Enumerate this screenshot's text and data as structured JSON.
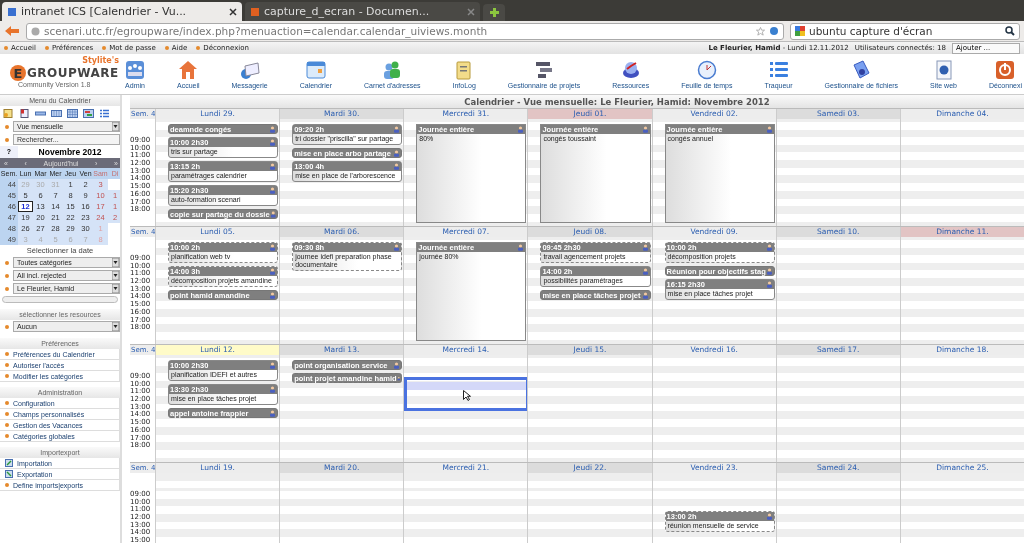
{
  "browser": {
    "tabs": [
      {
        "title": "intranet ICS [Calendrier - Vu...",
        "selected": true
      },
      {
        "title": "capture_d_ecran - Documen...",
        "selected": false
      }
    ],
    "url": "scenari.utc.fr/egroupware/index.php?menuaction=calendar.calendar_uiviews.month",
    "search": "ubuntu capture d'écran"
  },
  "top_links": [
    "Accueil",
    "Préférences",
    "Mot de passe",
    "Aide",
    "Déconnexion"
  ],
  "user_info": "**Le Fleurier, Hamid** - Lundi 12.11.2012",
  "users_online": "Utilisateurs connectés: 18",
  "add_select": "Ajouter ...",
  "logo": {
    "tagline": "Stylite's",
    "letter": "E",
    "name": "GROUPWARE",
    "version": "Community Version 1.8"
  },
  "apps": [
    "Admin",
    "Accueil",
    "Messagerie",
    "Calendrier",
    "Carnet d'adresses",
    "InfoLog",
    "Gestionnaire de projets",
    "Ressources",
    "Feuille de temps",
    "Traqueur",
    "Gestionnaire de fichiers",
    "Site web",
    "Déconnexi"
  ],
  "sidebar": {
    "title": "Menu du Calendrier",
    "view_select": "Vue mensuelle",
    "search_placeholder": "Rechercher...",
    "minical": {
      "help": "?",
      "month": "Novembre 2012",
      "nav": [
        "«",
        "‹",
        "Aujourd'hui",
        "›",
        "»"
      ],
      "heads": [
        "Sem.",
        "Lun",
        "Mar",
        "Mer",
        "Jeu",
        "Ven",
        "Sam",
        "Di"
      ],
      "weeks": [
        {
          "week": "44",
          "days": [
            {
              "label": "29",
              "kind": "other",
              "selected": false
            },
            {
              "label": "30",
              "kind": "other",
              "selected": false
            },
            {
              "label": "31",
              "kind": "other",
              "selected": false
            },
            {
              "label": "1",
              "kind": "day",
              "selected": false
            },
            {
              "label": "2",
              "kind": "day",
              "selected": false
            },
            {
              "label": "3",
              "kind": "weekend",
              "selected": false
            }
          ]
        },
        {
          "week": "45",
          "days": [
            {
              "label": "5",
              "kind": "day",
              "selected": false
            },
            {
              "label": "6",
              "kind": "day",
              "selected": false
            },
            {
              "label": "7",
              "kind": "day",
              "selected": false
            },
            {
              "label": "8",
              "kind": "day",
              "selected": false
            },
            {
              "label": "9",
              "kind": "day",
              "selected": false
            },
            {
              "label": "10",
              "kind": "weekend",
              "selected": false
            },
            {
              "label": "1",
              "kind": "weekend",
              "selected": false
            }
          ]
        },
        {
          "week": "46",
          "days": [
            {
              "label": "12",
              "kind": "day",
              "selected": true
            },
            {
              "label": "13",
              "kind": "day",
              "selected": false
            },
            {
              "label": "14",
              "kind": "day",
              "selected": false
            },
            {
              "label": "15",
              "kind": "day",
              "selected": false
            },
            {
              "label": "16",
              "kind": "day",
              "selected": false
            },
            {
              "label": "17",
              "kind": "weekend",
              "selected": false
            },
            {
              "label": "1",
              "kind": "weekend",
              "selected": false
            }
          ]
        },
        {
          "week": "47",
          "days": [
            {
              "label": "19",
              "kind": "day",
              "selected": false
            },
            {
              "label": "20",
              "kind": "day",
              "selected": false
            },
            {
              "label": "21",
              "kind": "day",
              "selected": false
            },
            {
              "label": "22",
              "kind": "day",
              "selected": false
            },
            {
              "label": "23",
              "kind": "day",
              "selected": false
            },
            {
              "label": "24",
              "kind": "weekend",
              "selected": false
            },
            {
              "label": "2",
              "kind": "weekend",
              "selected": false
            }
          ]
        },
        {
          "week": "48",
          "days": [
            {
              "label": "26",
              "kind": "day",
              "selected": false
            },
            {
              "label": "27",
              "kind": "day",
              "selected": false
            },
            {
              "label": "28",
              "kind": "day",
              "selected": false
            },
            {
              "label": "29",
              "kind": "day",
              "selected": false
            },
            {
              "label": "30",
              "kind": "day",
              "selected": false
            },
            {
              "label": "1",
              "kind": "other_weekend",
              "selected": false
            }
          ]
        },
        {
          "week": "49",
          "days": [
            {
              "label": "3",
              "kind": "other",
              "selected": false
            },
            {
              "label": "4",
              "kind": "other",
              "selected": false
            },
            {
              "label": "5",
              "kind": "other",
              "selected": false
            },
            {
              "label": "6",
              "kind": "other",
              "selected": false
            },
            {
              "label": "7",
              "kind": "other",
              "selected": false
            },
            {
              "label": "8",
              "kind": "other_weekend",
              "selected": false
            }
          ]
        }
      ],
      "caption": "Sélectionner la date"
    },
    "filters": [
      "Toutes catégories",
      "All incl. rejected",
      "Le Fleurier, Hamid"
    ],
    "resources": {
      "title": "sélectionner les resources",
      "select": "Aucun"
    },
    "sections": [
      {
        "title": "Préférences",
        "items": [
          {
            "label": "Préférences du Calendrier",
            "kind": "bullet"
          },
          {
            "label": "Autoriser l'accès",
            "kind": "bullet"
          },
          {
            "label": "Modifier les catégories",
            "kind": "bullet"
          }
        ]
      },
      {
        "title": "Administration",
        "items": [
          {
            "label": "Configuration",
            "kind": "bullet"
          },
          {
            "label": "Champs personnalisés",
            "kind": "bullet"
          },
          {
            "label": "Gestion des Vacances",
            "kind": "bullet"
          },
          {
            "label": "Catégories globales",
            "kind": "bullet"
          }
        ]
      },
      {
        "title": "Importexport",
        "items": [
          {
            "label": "Importation",
            "kind": "import"
          },
          {
            "label": "Exportation",
            "kind": "export"
          },
          {
            "label": "Define imports|exports",
            "kind": "bullet"
          }
        ]
      }
    ]
  },
  "calendar": {
    "title": "Calendrier - Vue mensuelle: Le Fleurier, Hamid: Novembre 2012",
    "weeks": [
      {
        "label": "Sem. 4",
        "hours": [
          "09:00",
          "10:00",
          "11:00",
          "12:00",
          "13:00",
          "14:00",
          "15:00",
          "16:00",
          "17:00",
          "18:00"
        ],
        "days": [
          {
            "label": "Lundi 29.",
            "today": false,
            "holiday": false,
            "selected": false,
            "events": [
              {
                "kind": "bar",
                "title": "deamnde congés",
                "dashed": false
              },
              {
                "kind": "timed",
                "title": "10:00 2h30",
                "text": "tris sur partage",
                "dashed": false
              },
              {
                "kind": "timed",
                "title": "13:15 2h",
                "text": "paramétrages calendrier",
                "dashed": false
              },
              {
                "kind": "timed",
                "title": "15:20 2h30",
                "text": "auto-formation scenari",
                "dashed": false
              },
              {
                "kind": "bar",
                "title": "copie sur partage du dossie",
                "dashed": false
              }
            ]
          },
          {
            "label": "Mardi 30.",
            "today": false,
            "holiday": false,
            "selected": false,
            "events": [
              {
                "kind": "timed",
                "title": "09:20 2h",
                "text": "tri dossier \"priscilla\" sur partage",
                "dashed": false
              },
              {
                "kind": "bar",
                "title": "mise en place arbo partage",
                "dashed": false
              },
              {
                "kind": "timed",
                "title": "13:00 4h",
                "text": "mise en place de l'arborescence",
                "dashed": false
              }
            ]
          },
          {
            "label": "Mercredi 31.",
            "today": false,
            "holiday": false,
            "selected": false,
            "events": [
              {
                "kind": "allday",
                "title": "Journée entière",
                "text": "80%",
                "dashed": false
              }
            ]
          },
          {
            "label": "Jeudi 01.",
            "today": false,
            "holiday": true,
            "selected": false,
            "events": [
              {
                "kind": "allday",
                "title": "Journée entière",
                "text": "congés toussaint",
                "dashed": false
              }
            ]
          },
          {
            "label": "Vendredi 02.",
            "today": false,
            "holiday": false,
            "selected": false,
            "events": [
              {
                "kind": "allday",
                "title": "Journée entière",
                "text": "congés annuel",
                "dashed": false
              }
            ]
          },
          {
            "label": "Samedi 03.",
            "today": false,
            "holiday": false,
            "selected": false
          },
          {
            "label": "Dimanche 04.",
            "today": false,
            "holiday": false,
            "selected": false
          }
        ]
      },
      {
        "label": "Sem. 4",
        "hours": [
          "09:00",
          "10:00",
          "11:00",
          "12:00",
          "13:00",
          "14:00",
          "15:00",
          "16:00",
          "17:00",
          "18:00"
        ],
        "days": [
          {
            "label": "Lundi 05.",
            "today": false,
            "holiday": false,
            "selected": false,
            "events": [
              {
                "kind": "timed",
                "title": "10:00 2h",
                "text": "planification web tv",
                "dashed": true
              },
              {
                "kind": "timed",
                "title": "14:00 3h",
                "text": "décomposition projets amandine",
                "dashed": true
              },
              {
                "kind": "bar",
                "title": "point hamid amandine",
                "dashed": false
              }
            ]
          },
          {
            "label": "Mardi 06.",
            "today": false,
            "holiday": false,
            "selected": false,
            "events": [
              {
                "kind": "timed",
                "title": "09:30 8h",
                "text": "journee idefi preparation phase documentaire",
                "dashed": true
              }
            ]
          },
          {
            "label": "Mercredi 07.",
            "today": false,
            "holiday": false,
            "selected": false,
            "events": [
              {
                "kind": "allday",
                "title": "Journée entière",
                "text": "journée 80%",
                "dashed": false
              }
            ]
          },
          {
            "label": "Jeudi 08.",
            "today": false,
            "holiday": false,
            "selected": false,
            "events": [
              {
                "kind": "timed",
                "title": "09:45 2h30",
                "text": "travail agencement projets",
                "dashed": true
              },
              {
                "kind": "timed",
                "title": "14:00 2h",
                "text": "possibilités paramétrages",
                "dashed": false
              },
              {
                "kind": "bar",
                "title": "mise en place tâches projet",
                "dashed": false
              }
            ]
          },
          {
            "label": "Vendredi 09.",
            "today": false,
            "holiday": false,
            "selected": false,
            "events": [
              {
                "kind": "timed",
                "title": "10:00 2h",
                "text": "décomposition projets",
                "dashed": true
              },
              {
                "kind": "bar",
                "title": "Réunion pour objectifs stag",
                "dashed": false
              },
              {
                "kind": "timed",
                "title": "16:15 2h30",
                "text": "mise en place tâches projet",
                "dashed": false
              }
            ]
          },
          {
            "label": "Samedi 10.",
            "today": false,
            "holiday": false,
            "selected": false
          },
          {
            "label": "Dimanche 11.",
            "today": false,
            "holiday": true,
            "selected": false
          }
        ]
      },
      {
        "label": "Sem. 4",
        "hours": [
          "09:00",
          "10:00",
          "11:00",
          "12:00",
          "13:00",
          "14:00",
          "15:00",
          "16:00",
          "17:00",
          "18:00"
        ],
        "days": [
          {
            "label": "Lundi 12.",
            "today": true,
            "holiday": false,
            "selected": false,
            "events": [
              {
                "kind": "timed",
                "title": "10:00 2h30",
                "text": "planification IDEFI et autres",
                "dashed": false
              },
              {
                "kind": "timed",
                "title": "13:30 2h30",
                "text": "mise en place tâches projet",
                "dashed": false
              },
              {
                "kind": "bar",
                "title": "appel antoine frappier",
                "dashed": false
              }
            ]
          },
          {
            "label": "Mardi 13.",
            "today": false,
            "holiday": false,
            "selected": false,
            "events": [
              {
                "kind": "bar",
                "title": "point organisation service",
                "dashed": false
              },
              {
                "kind": "bar",
                "title": "point projet amandine hamid",
                "dashed": true
              }
            ]
          },
          {
            "label": "Mercredi 14.",
            "today": false,
            "holiday": false,
            "selected": true
          },
          {
            "label": "Jeudi 15.",
            "today": false,
            "holiday": false,
            "selected": false
          },
          {
            "label": "Vendredi 16.",
            "today": false,
            "holiday": false,
            "selected": false
          },
          {
            "label": "Samedi 17.",
            "today": false,
            "holiday": false,
            "selected": false
          },
          {
            "label": "Dimanche 18.",
            "today": false,
            "holiday": false,
            "selected": false
          }
        ]
      },
      {
        "label": "Sem. 4",
        "hours": [
          "09:00",
          "10:00",
          "11:00",
          "12:00",
          "13:00",
          "14:00",
          "15:00"
        ],
        "days": [
          {
            "label": "Lundi 19.",
            "today": false,
            "holiday": false,
            "selected": false
          },
          {
            "label": "Mardi 20.",
            "today": false,
            "holiday": false,
            "selected": false
          },
          {
            "label": "Mercredi 21.",
            "today": false,
            "holiday": false,
            "selected": false
          },
          {
            "label": "Jeudi 22.",
            "today": false,
            "holiday": false,
            "selected": false
          },
          {
            "label": "Vendredi 23.",
            "today": false,
            "holiday": false,
            "selected": false,
            "events": [
              {
                "kind": "spacer_timed",
                "title": "13:00 2h",
                "text": "réunion mensuelle de service",
                "dashed": true
              }
            ]
          },
          {
            "label": "Samedi 24.",
            "today": false,
            "holiday": false,
            "selected": false
          },
          {
            "label": "Dimanche 25.",
            "today": false,
            "holiday": false,
            "selected": false
          }
        ]
      }
    ]
  }
}
